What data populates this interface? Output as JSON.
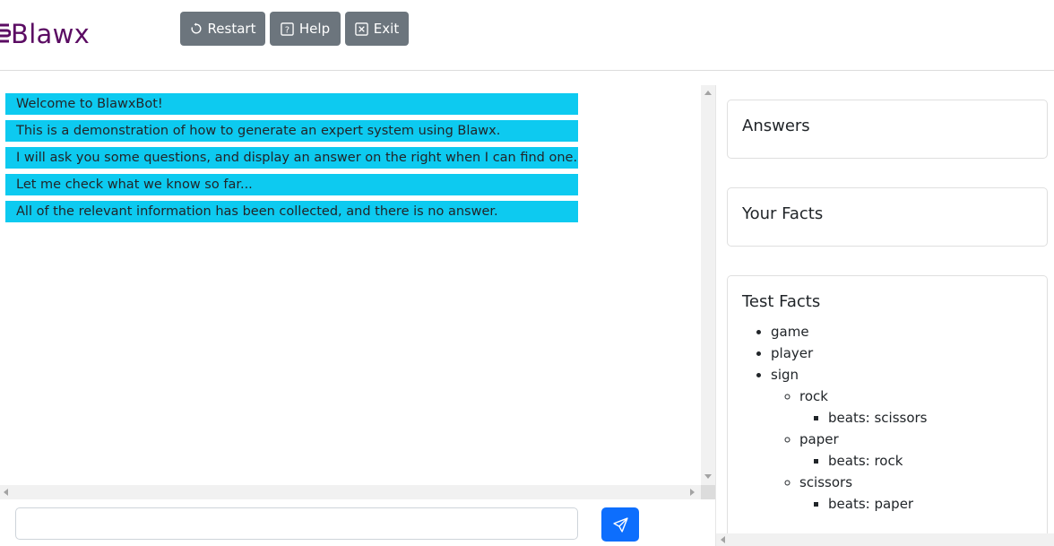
{
  "header": {
    "brand": "Blawx",
    "brand_color": "#5b0c63",
    "buttons": {
      "restart": {
        "label": "Restart",
        "icon": "restart-icon"
      },
      "help": {
        "label": "Help",
        "icon": "question-square-icon"
      },
      "exit": {
        "label": "Exit",
        "icon": "close-square-icon"
      }
    }
  },
  "chat": {
    "messages": [
      "Welcome to BlawxBot!",
      "This is a demonstration of how to generate an expert system using Blawx.",
      "I will ask you some questions, and display an answer on the right when I can find one.",
      "Let me check what we know so far...",
      "All of the relevant information has been collected, and there is no answer."
    ],
    "message_color": "#0dcaf0",
    "input_value": "",
    "send_icon": "send-icon",
    "send_color": "#0d6efd"
  },
  "sidebar": {
    "answers_title": "Answers",
    "facts_title": "Your Facts",
    "test_facts_title": "Test Facts",
    "test_facts": {
      "game": "game",
      "player": "player",
      "sign": "sign",
      "rock": "rock",
      "rock_beats": "beats: scissors",
      "paper": "paper",
      "paper_beats": "beats: rock",
      "scissors": "scissors",
      "scissors_beats": "beats: paper"
    }
  }
}
